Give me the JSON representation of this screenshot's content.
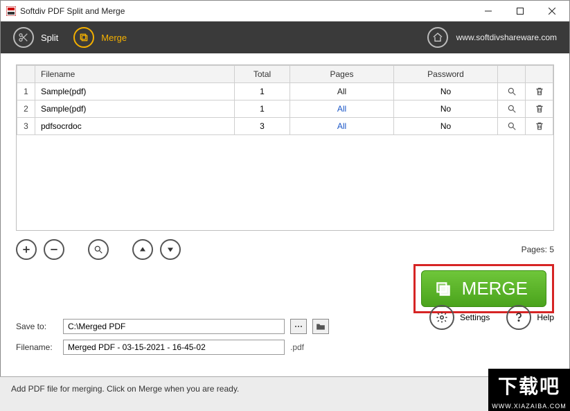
{
  "window": {
    "title": "Softdiv PDF Split and Merge"
  },
  "toolbar": {
    "split_label": "Split",
    "merge_label": "Merge",
    "url": "www.softdivshareware.com"
  },
  "table": {
    "headers": {
      "num": "",
      "filename": "Filename",
      "total": "Total",
      "pages": "Pages",
      "password": "Password"
    },
    "rows": [
      {
        "num": "1",
        "filename": "Sample(pdf)",
        "total": "1",
        "pages": "All",
        "password": "No"
      },
      {
        "num": "2",
        "filename": "Sample(pdf)",
        "total": "1",
        "pages": "All",
        "password": "No"
      },
      {
        "num": "3",
        "filename": "pdfsocrdoc",
        "total": "3",
        "pages": "All",
        "password": "No"
      }
    ]
  },
  "pages_total": "Pages: 5",
  "merge_button": "MERGE",
  "save": {
    "label": "Save to:",
    "value": "C:\\Merged PDF",
    "filename_label": "Filename:",
    "filename_value": "Merged PDF - 03-15-2021 - 16-45-02",
    "ext": ".pdf"
  },
  "bottom": {
    "settings": "Settings",
    "help": "Help"
  },
  "status": "Add PDF file for merging. Click on Merge when you are ready.",
  "watermark": {
    "text": "下载吧",
    "sub": "WWW.XIAZAIBA.COM"
  }
}
